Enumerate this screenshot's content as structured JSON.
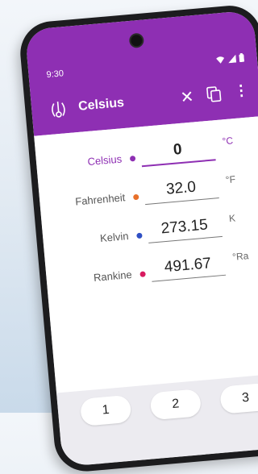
{
  "status_bar": {
    "time": "9:30"
  },
  "toolbar": {
    "title": "Celsius",
    "close_icon": "✕",
    "more_icon": "⋮"
  },
  "colors": {
    "accent": "#8e2fb3",
    "fahrenheit": "#e8702a",
    "kelvin": "#2f4fc4",
    "rankine": "#d81b60"
  },
  "units": [
    {
      "label": "Celsius",
      "value": "0",
      "symbol": "°C"
    },
    {
      "label": "Fahrenheit",
      "value": "32.0",
      "symbol": "°F"
    },
    {
      "label": "Kelvin",
      "value": "273.15",
      "symbol": "K"
    },
    {
      "label": "Rankine",
      "value": "491.67",
      "symbol": "°Ra"
    }
  ],
  "keypad": {
    "keys": [
      "1",
      "2",
      "3"
    ]
  }
}
